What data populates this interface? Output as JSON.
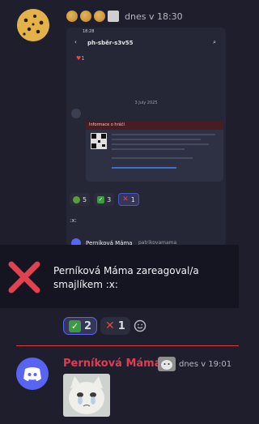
{
  "message1": {
    "timestamp": "dnes v 18:30"
  },
  "screenshot": {
    "status_time": "18:28",
    "channel": "ph-sběr-s3v55",
    "date_divider": "3 July 2025",
    "card_title": "Informace o hráči",
    "chips": [
      {
        "count": "5"
      },
      {
        "count": "3"
      },
      {
        "count": "1"
      }
    ],
    "command_text": ":x:",
    "author_name": "Perníková Máma",
    "author_tag": "patrikovamama"
  },
  "notification": {
    "text": "Perníková Máma zareagoval/a smajlíkem :x:"
  },
  "reactions": [
    {
      "emoji": "check",
      "count": "2",
      "active": true
    },
    {
      "emoji": "x",
      "count": "1",
      "active": false
    }
  ],
  "message2": {
    "author": "Perníková Máma",
    "timestamp": "dnes v 19:01"
  },
  "colors": {
    "accent": "#5865f2",
    "danger": "#d73d46",
    "author": "#e23b52",
    "background": "#1e1e2c"
  }
}
